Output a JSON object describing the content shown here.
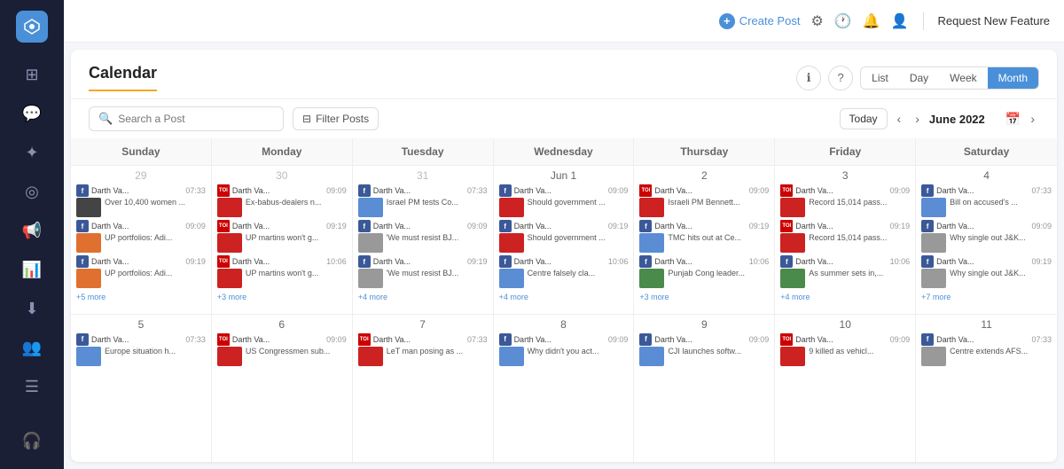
{
  "sidebar": {
    "logo_label": "→",
    "icons": [
      {
        "name": "dashboard-icon",
        "symbol": "⊞"
      },
      {
        "name": "chat-icon",
        "symbol": "💬"
      },
      {
        "name": "analytics-icon",
        "symbol": "✦"
      },
      {
        "name": "monitor-icon",
        "symbol": "◎"
      },
      {
        "name": "megaphone-icon",
        "symbol": "📢"
      },
      {
        "name": "chart-icon",
        "symbol": "📊"
      },
      {
        "name": "download-icon",
        "symbol": "⬇"
      },
      {
        "name": "people-icon",
        "symbol": "👥"
      },
      {
        "name": "list-icon",
        "symbol": "☰"
      },
      {
        "name": "support-icon",
        "symbol": "🎧"
      }
    ]
  },
  "topbar": {
    "create_post_label": "Create Post",
    "request_feature_label": "Request New Feature"
  },
  "calendar": {
    "title": "Calendar",
    "view_tabs": [
      "List",
      "Day",
      "Week",
      "Month"
    ],
    "active_tab": "Month",
    "search_placeholder": "Search a Post",
    "filter_label": "Filter Posts",
    "today_label": "Today",
    "current_month": "June 2022",
    "day_headers": [
      "Sunday",
      "Monday",
      "Tuesday",
      "Wednesday",
      "Thursday",
      "Friday",
      "Saturday"
    ],
    "weeks": [
      {
        "days": [
          {
            "num": "29",
            "other": true,
            "posts": [
              {
                "user": "Darth Va...",
                "time": "07:33",
                "icon": "fb",
                "headline": "Over 10,400 women ...",
                "color": "dark"
              },
              {
                "user": "Darth Va...",
                "time": "09:09",
                "icon": "fb",
                "headline": "UP portfolios: Adi...",
                "color": "orange"
              },
              {
                "user": "Darth Va...",
                "time": "09:19",
                "icon": "fb",
                "headline": "UP portfolios: Adi...",
                "color": "orange"
              }
            ],
            "more": "+5 more"
          },
          {
            "num": "30",
            "other": true,
            "posts": [
              {
                "user": "Darth Va...",
                "time": "09:09",
                "icon": "toi",
                "headline": "Ex-babus-dealers n...",
                "color": "red"
              },
              {
                "user": "Darth Va...",
                "time": "09:19",
                "icon": "toi",
                "headline": "UP martins won't g...",
                "color": "red"
              },
              {
                "user": "Darth Va...",
                "time": "10:06",
                "icon": "toi",
                "headline": "UP martins won't g...",
                "color": "red"
              }
            ],
            "more": "+3 more"
          },
          {
            "num": "31",
            "other": true,
            "posts": [
              {
                "user": "Darth Va...",
                "time": "07:33",
                "icon": "fb",
                "headline": "Israel PM tests Co...",
                "color": "blue"
              },
              {
                "user": "Darth Va...",
                "time": "09:09",
                "icon": "fb",
                "headline": "'We must resist BJ...",
                "color": "gray"
              },
              {
                "user": "Darth Va...",
                "time": "09:19",
                "icon": "fb",
                "headline": "'We must resist BJ...",
                "color": "gray"
              }
            ],
            "more": "+4 more"
          },
          {
            "num": "Jun 1",
            "other": false,
            "posts": [
              {
                "user": "Darth Va...",
                "time": "09:09",
                "icon": "fb",
                "headline": "Should government ...",
                "color": "red"
              },
              {
                "user": "Darth Va...",
                "time": "09:19",
                "icon": "fb",
                "headline": "Should government ...",
                "color": "red"
              },
              {
                "user": "Darth Va...",
                "time": "10:06",
                "icon": "fb",
                "headline": "Centre falsely cla...",
                "color": "blue"
              }
            ],
            "more": "+4 more"
          },
          {
            "num": "2",
            "other": false,
            "posts": [
              {
                "user": "Darth Va...",
                "time": "09:09",
                "icon": "toi",
                "headline": "Israeli PM Bennett...",
                "color": "red"
              },
              {
                "user": "Darth Va...",
                "time": "09:19",
                "icon": "fb",
                "headline": "TMC hits out at Ce...",
                "color": "blue"
              },
              {
                "user": "Darth Va...",
                "time": "10:06",
                "icon": "fb",
                "headline": "Punjab Cong leader...",
                "color": "green"
              }
            ],
            "more": "+3 more"
          },
          {
            "num": "3",
            "other": false,
            "posts": [
              {
                "user": "Darth Va...",
                "time": "09:09",
                "icon": "toi",
                "headline": "Record 15,014 pass...",
                "color": "red"
              },
              {
                "user": "Darth Va...",
                "time": "09:19",
                "icon": "toi",
                "headline": "Record 15,014 pass...",
                "color": "red"
              },
              {
                "user": "Darth Va...",
                "time": "10:06",
                "icon": "fb",
                "headline": "As summer sets in,...",
                "color": "green"
              }
            ],
            "more": "+4 more"
          },
          {
            "num": "4",
            "other": false,
            "posts": [
              {
                "user": "Darth Va...",
                "time": "07:33",
                "icon": "fb",
                "headline": "Bill on accused's ...",
                "color": "blue"
              },
              {
                "user": "Darth Va...",
                "time": "09:09",
                "icon": "fb",
                "headline": "Why single out J&K...",
                "color": "gray"
              },
              {
                "user": "Darth Va...",
                "time": "09:19",
                "icon": "fb",
                "headline": "Why single out J&K...",
                "color": "gray"
              }
            ],
            "more": "+7 more"
          }
        ]
      },
      {
        "days": [
          {
            "num": "5",
            "other": false,
            "posts": [
              {
                "user": "Darth Va...",
                "time": "07:33",
                "icon": "fb",
                "headline": "Europe situation h...",
                "color": "blue"
              }
            ],
            "more": null
          },
          {
            "num": "6",
            "other": false,
            "posts": [
              {
                "user": "Darth Va...",
                "time": "09:09",
                "icon": "toi",
                "headline": "US Congressmen sub...",
                "color": "red"
              }
            ],
            "more": null
          },
          {
            "num": "7",
            "other": false,
            "posts": [
              {
                "user": "Darth Va...",
                "time": "07:33",
                "icon": "toi",
                "headline": "LeT man posing as ...",
                "color": "red"
              }
            ],
            "more": null
          },
          {
            "num": "8",
            "other": false,
            "posts": [
              {
                "user": "Darth Va...",
                "time": "09:09",
                "icon": "fb",
                "headline": "Why didn't you act...",
                "color": "blue"
              }
            ],
            "more": null
          },
          {
            "num": "9",
            "other": false,
            "posts": [
              {
                "user": "Darth Va...",
                "time": "09:09",
                "icon": "fb",
                "headline": "CJI launches softw...",
                "color": "blue"
              }
            ],
            "more": null
          },
          {
            "num": "10",
            "other": false,
            "posts": [
              {
                "user": "Darth Va...",
                "time": "09:09",
                "icon": "toi",
                "headline": "9 killed as vehicl...",
                "color": "red"
              }
            ],
            "more": null
          },
          {
            "num": "11",
            "other": false,
            "posts": [
              {
                "user": "Darth Va...",
                "time": "07:33",
                "icon": "fb",
                "headline": "Centre extends AFS...",
                "color": "gray"
              }
            ],
            "more": null
          }
        ]
      }
    ]
  }
}
